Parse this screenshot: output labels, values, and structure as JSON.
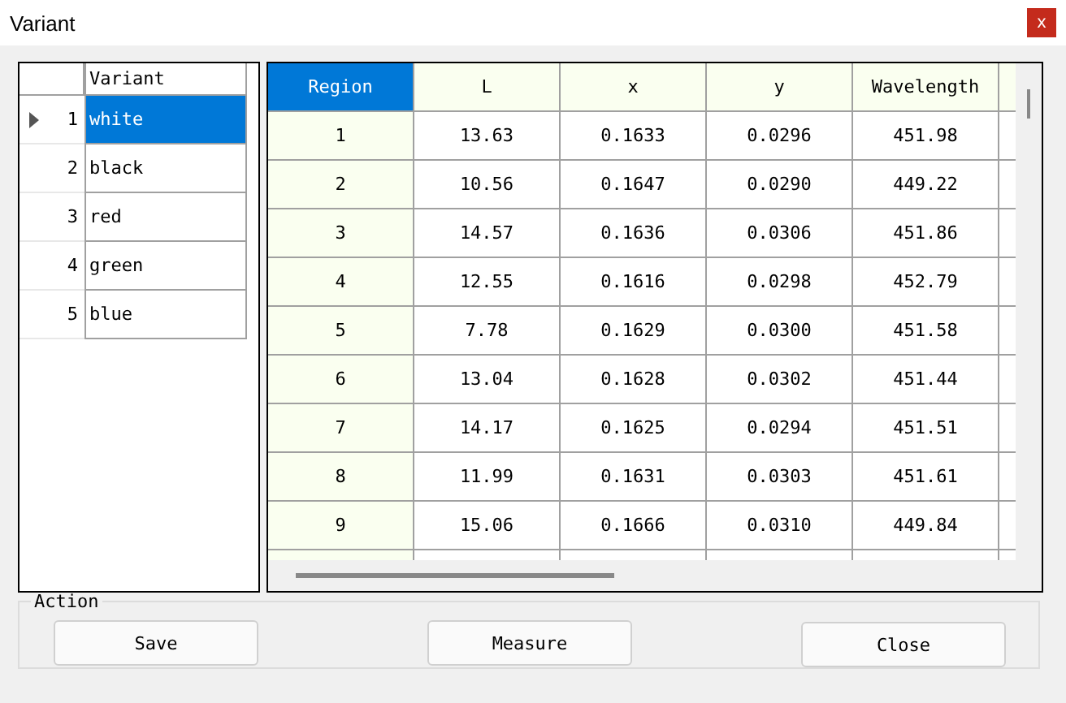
{
  "window": {
    "title": "Variant",
    "close": "x"
  },
  "variants": {
    "header": "Variant",
    "rows": [
      {
        "index": "1",
        "name": "white",
        "selected": true
      },
      {
        "index": "2",
        "name": "black",
        "selected": false
      },
      {
        "index": "3",
        "name": "red",
        "selected": false
      },
      {
        "index": "4",
        "name": "green",
        "selected": false
      },
      {
        "index": "5",
        "name": "blue",
        "selected": false
      }
    ]
  },
  "table": {
    "columns": [
      {
        "label": "Region",
        "selected": true
      },
      {
        "label": "L",
        "selected": false
      },
      {
        "label": "x",
        "selected": false
      },
      {
        "label": "y",
        "selected": false
      },
      {
        "label": "Wavelength",
        "selected": false
      }
    ],
    "rows": [
      [
        "1",
        "13.63",
        "0.1633",
        "0.0296",
        "451.98"
      ],
      [
        "2",
        "10.56",
        "0.1647",
        "0.0290",
        "449.22"
      ],
      [
        "3",
        "14.57",
        "0.1636",
        "0.0306",
        "451.86"
      ],
      [
        "4",
        "12.55",
        "0.1616",
        "0.0298",
        "452.79"
      ],
      [
        "5",
        "7.78",
        "0.1629",
        "0.0300",
        "451.58"
      ],
      [
        "6",
        "13.04",
        "0.1628",
        "0.0302",
        "451.44"
      ],
      [
        "7",
        "14.17",
        "0.1625",
        "0.0294",
        "451.51"
      ],
      [
        "8",
        "11.99",
        "0.1631",
        "0.0303",
        "451.61"
      ],
      [
        "9",
        "15.06",
        "0.1666",
        "0.0310",
        "449.84"
      ]
    ]
  },
  "action": {
    "title": "Action",
    "buttons": [
      "Save",
      "Measure",
      "Close"
    ]
  }
}
